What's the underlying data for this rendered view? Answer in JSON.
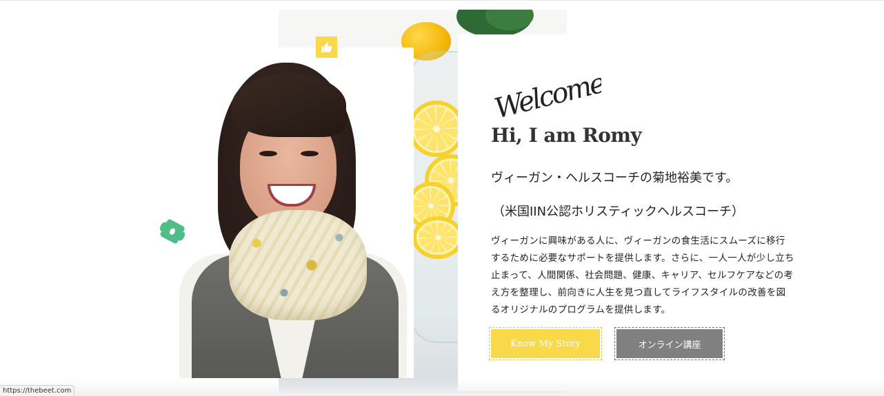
{
  "hero": {
    "welcome_script": "Welcome",
    "greeting": "Hi, I am Romy",
    "intro_line_1": "ヴィーガン・ヘルスコーチの菊地裕美です。",
    "intro_line_2": "（米国IIN公認ホリスティックヘルスコーチ）",
    "description": "ヴィーガンに興味がある人に、ヴィーガンの食生活にスムーズに移行するために必要なサポートを提供します。さらに、一人一人が少し立ち止まって、人間関係、社会問題、健康、キャリア、セルフケアなどの考え方を整理し、前向きに人生を見つ直してライフスタイルの改善を図るオリジナルのプログラムを提供します。",
    "buttons": {
      "story": "Know My Story",
      "online_course": "オンライン講座"
    }
  },
  "icons": {
    "thumb": "thumbs-up-icon",
    "leaf": "leaf-icon"
  },
  "status_bar": {
    "url": "https://thebeet.com"
  },
  "colors": {
    "accent_yellow": "#f9d84a",
    "accent_green": "#4fbd85",
    "button_gray": "#808080",
    "text": "#222222"
  }
}
